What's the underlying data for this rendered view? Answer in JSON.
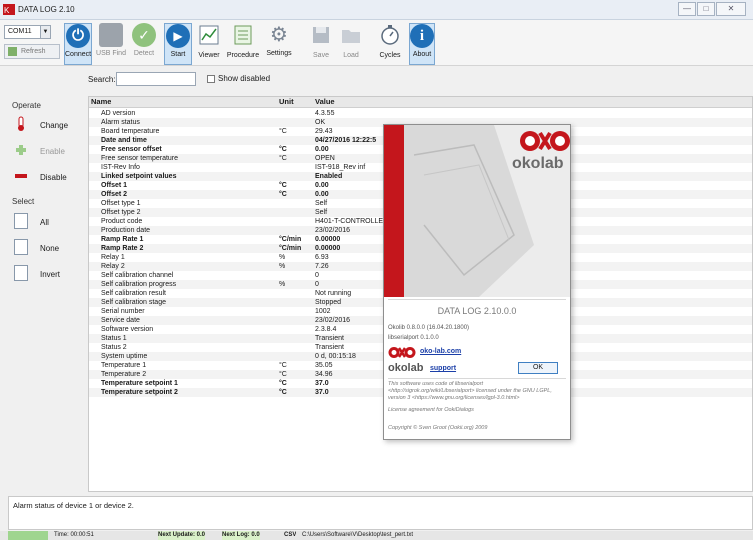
{
  "window": {
    "title": "DATA LOG 2.10",
    "buttons": [
      "—",
      "□",
      "✕"
    ]
  },
  "toolbar": {
    "port": "COM11",
    "refresh": "Refresh",
    "buttons": [
      {
        "label": "Connect",
        "icon": "power-icon"
      },
      {
        "label": "USB Find",
        "icon": "usb-icon"
      },
      {
        "label": "Detect",
        "icon": "check-icon"
      },
      {
        "label": "Start",
        "icon": "play-icon"
      },
      {
        "label": "Viewer",
        "icon": "chart-icon"
      },
      {
        "label": "Procedure",
        "icon": "list-icon"
      },
      {
        "label": "Settings",
        "icon": "gear-icon"
      },
      {
        "label": "Save",
        "icon": "save-icon"
      },
      {
        "label": "Load",
        "icon": "folder-icon"
      },
      {
        "label": "Cycles",
        "icon": "timer-icon"
      },
      {
        "label": "About",
        "icon": "info-icon"
      }
    ]
  },
  "filter": {
    "search_label": "Search:",
    "show_disabled": "Show disabled"
  },
  "sidebar": {
    "operate_title": "Operate",
    "operate": [
      {
        "label": "Change"
      },
      {
        "label": "Enable"
      },
      {
        "label": "Disable"
      }
    ],
    "select_title": "Select",
    "select": [
      {
        "label": "All"
      },
      {
        "label": "None"
      },
      {
        "label": "Invert"
      }
    ]
  },
  "table": {
    "headers": [
      "Name",
      "Unit",
      "Value"
    ],
    "rows": [
      {
        "name": "AD version",
        "unit": "",
        "value": "4.3.55",
        "bold": false
      },
      {
        "name": "Alarm status",
        "unit": "",
        "value": "OK",
        "bold": false
      },
      {
        "name": "Board temperature",
        "unit": "°C",
        "value": "29.43",
        "bold": false
      },
      {
        "name": "Date and time",
        "unit": "",
        "value": "04/27/2016 12:22:5",
        "bold": true
      },
      {
        "name": "Free sensor offset",
        "unit": "°C",
        "value": "0.00",
        "bold": true
      },
      {
        "name": "Free sensor temperature",
        "unit": "°C",
        "value": "OPEN",
        "bold": false
      },
      {
        "name": "IST-Rev Info",
        "unit": "",
        "value": "IST-918_Rev inf",
        "bold": false
      },
      {
        "name": "Linked setpoint values",
        "unit": "",
        "value": "Enabled",
        "bold": true
      },
      {
        "name": "Offset 1",
        "unit": "°C",
        "value": "0.00",
        "bold": true
      },
      {
        "name": "Offset 2",
        "unit": "°C",
        "value": "0.00",
        "bold": true
      },
      {
        "name": "Offset type 1",
        "unit": "",
        "value": "Self",
        "bold": false
      },
      {
        "name": "Offset type 2",
        "unit": "",
        "value": "Self",
        "bold": false
      },
      {
        "name": "Product code",
        "unit": "",
        "value": "H401-T-CONTROLLE",
        "bold": false
      },
      {
        "name": "Production date",
        "unit": "",
        "value": "23/02/2016",
        "bold": false
      },
      {
        "name": "Ramp Rate 1",
        "unit": "°C/min",
        "value": "0.00000",
        "bold": true
      },
      {
        "name": "Ramp Rate 2",
        "unit": "°C/min",
        "value": "0.00000",
        "bold": true
      },
      {
        "name": "Relay 1",
        "unit": "%",
        "value": "6.93",
        "bold": false
      },
      {
        "name": "Relay 2",
        "unit": "%",
        "value": "7.26",
        "bold": false
      },
      {
        "name": "Self calibration channel",
        "unit": "",
        "value": "0",
        "bold": false
      },
      {
        "name": "Self calibration progress",
        "unit": "%",
        "value": "0",
        "bold": false
      },
      {
        "name": "Self calibration result",
        "unit": "",
        "value": "Not running",
        "bold": false
      },
      {
        "name": "Self calibration stage",
        "unit": "",
        "value": "Stopped",
        "bold": false
      },
      {
        "name": "Serial number",
        "unit": "",
        "value": "1002",
        "bold": false
      },
      {
        "name": "Service date",
        "unit": "",
        "value": "23/02/2016",
        "bold": false
      },
      {
        "name": "Software version",
        "unit": "",
        "value": "2.3.8.4",
        "bold": false
      },
      {
        "name": "Status 1",
        "unit": "",
        "value": "Transient",
        "bold": false
      },
      {
        "name": "Status 2",
        "unit": "",
        "value": "Transient",
        "bold": false
      },
      {
        "name": "System uptime",
        "unit": "",
        "value": "0 d, 00:15:18",
        "bold": false
      },
      {
        "name": "Temperature 1",
        "unit": "°C",
        "value": "35.05",
        "bold": false
      },
      {
        "name": "Temperature 2",
        "unit": "°C",
        "value": "34.96",
        "bold": false
      },
      {
        "name": "Temperature setpoint 1",
        "unit": "°C",
        "value": "37.0",
        "bold": true
      },
      {
        "name": "Temperature setpoint 2",
        "unit": "°C",
        "value": "37.0",
        "bold": true
      }
    ]
  },
  "status_message": "Alarm status of device 1 or device 2.",
  "statusbar": {
    "time": "Time: 00:00:51",
    "next_update": "Next Update: 0.0",
    "next_log": "Next Log: 0.0",
    "csv": "CSV",
    "path": "C:\\Users\\Software\\V\\Desktop\\test_pert.txt"
  },
  "about": {
    "version": "DATA LOG 2.10.0.0",
    "okolib": "Okolib 0.8.0.0 (16.04.20.1800)",
    "libserialport": "libserialport 0.1.0.0",
    "website": "oko-lab.com",
    "support": "support",
    "ok": "OK",
    "brand": "okolab",
    "license_text": "This software uses code of libserialport <http://sigrok.org/wiki/Libserialport> licensed under the GNU LGPL, version 3 <https://www.gnu.org/licenses/lgpl-3.0.html>",
    "agreement": "License agreement for OokiDialogs",
    "copyright": "Copyright © Sven Groot (Ookii.org) 2009"
  },
  "colors": {
    "accent": "#1f6fb7",
    "brand_red": "#c4161c",
    "selected_bg": "#cfe4f7"
  }
}
